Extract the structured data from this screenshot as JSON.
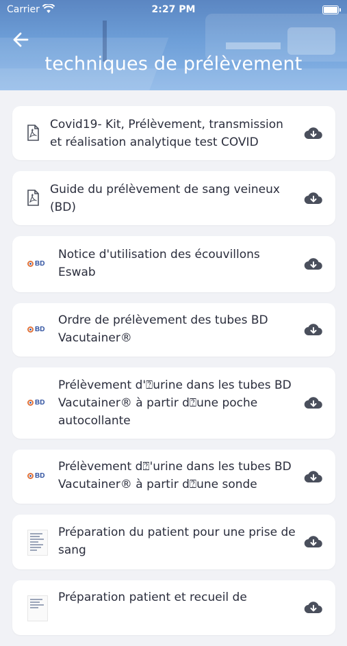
{
  "status_bar": {
    "carrier": "Carrier",
    "time": "2:27 PM"
  },
  "header": {
    "title": "techniques de prélèvement"
  },
  "items": [
    {
      "icon": "pdf-icon",
      "label": "Covid19- Kit, Prélèvement, transmission et réalisation analytique test COVID"
    },
    {
      "icon": "pdf-icon",
      "label": "Guide du prélèvement de sang veineux (BD)"
    },
    {
      "icon": "bd-logo",
      "label": "Notice d'utilisation des écouvillons Eswab",
      "logo_text": "BD"
    },
    {
      "icon": "bd-logo",
      "label": "Ordre de prélèvement des tubes BD Vacutainer®",
      "logo_text": "BD"
    },
    {
      "icon": "bd-logo",
      "label": "Prélèvement d'⍰urine dans les tubes BD Vacutainer® à partir d⍰une poche autocollante",
      "logo_text": "BD"
    },
    {
      "icon": "bd-logo",
      "label": "Prélèvement d⍰'urine dans les tubes BD Vacutainer® à partir d⍰une sonde",
      "logo_text": "BD"
    },
    {
      "icon": "document-thumbnail",
      "label": "Préparation du patient pour une prise de sang"
    },
    {
      "icon": "document-thumbnail",
      "label": "Préparation patient et recueil de"
    }
  ],
  "colors": {
    "accent": "#5b86c2",
    "background": "#f1f2f6",
    "icon": "#4a4f5c",
    "text": "#2a2d3c"
  }
}
